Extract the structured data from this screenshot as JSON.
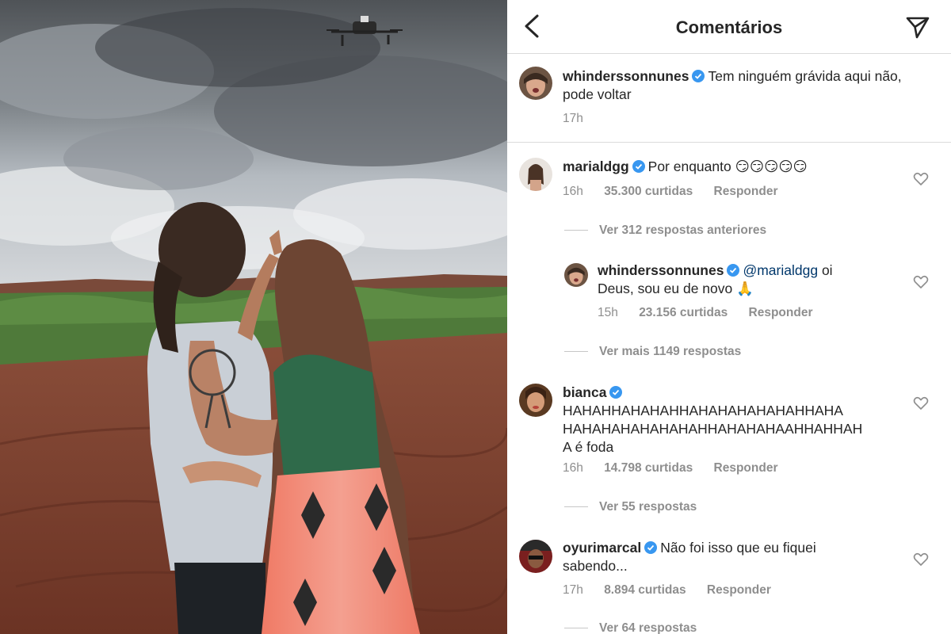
{
  "header": {
    "title": "Comentários",
    "back_icon": "chevron-left-icon",
    "share_icon": "paper-plane-icon"
  },
  "caption": {
    "username": "whinderssonnunes",
    "verified": true,
    "text_line1": "Tem ninguém grávida aqui não,",
    "text_line2": "pode voltar",
    "time": "17h"
  },
  "comments": [
    {
      "username": "marialdgg",
      "verified": true,
      "text": "Por enquanto 😏😏😏😏😏",
      "time": "16h",
      "likes": "35.300 curtidas",
      "reply_label": "Responder",
      "view_replies": "Ver 312 respostas anteriores",
      "reply": {
        "username": "whinderssonnunes",
        "verified": true,
        "mention": "@marialdgg",
        "text_line1_rest": "oi",
        "text_line2": "Deus, sou eu de novo 🙏",
        "time": "15h",
        "likes": "23.156 curtidas",
        "reply_label": "Responder"
      },
      "view_more": "Ver mais 1149 respostas"
    },
    {
      "username": "bianca",
      "verified": true,
      "text_line1": "HAHAHHAHAHAHHAHAHAHAHAHAHHAHA",
      "text_line2": "HAHAHAHAHAHAHAHHAHAHAHAAHHAHHAH",
      "text_line3": "A é foda",
      "time": "16h",
      "likes": "14.798 curtidas",
      "reply_label": "Responder",
      "view_replies": "Ver 55 respostas"
    },
    {
      "username": "oyurimarcal",
      "verified": true,
      "text_line1": "Não foi isso que eu fiquei",
      "text_line2": "sabendo...",
      "time": "17h",
      "likes": "8.894 curtidas",
      "reply_label": "Responder",
      "view_replies": "Ver 64 respostas"
    }
  ],
  "colors": {
    "verified_blue": "#3897f0",
    "secondary_text": "#8e8e8e",
    "mention": "#00376b",
    "divider": "#dbdbdb"
  }
}
